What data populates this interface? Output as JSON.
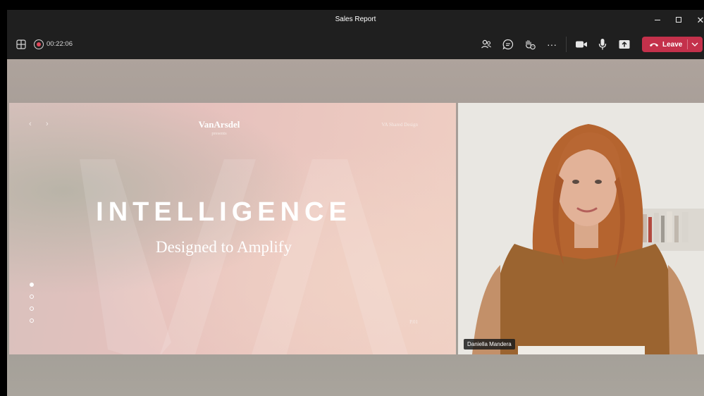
{
  "window": {
    "title": "Sales Report",
    "controls": {
      "minimize": "minimize",
      "maximize": "maximize",
      "close": "✕"
    }
  },
  "toolbar": {
    "layout_icon": "grid-layout-icon",
    "recording_icon": "recording-icon",
    "timer": "00:22:06",
    "more": "···",
    "leave_label": "Leave"
  },
  "slide": {
    "brand": "VanArsdel",
    "brand_sub": "presents",
    "shared_design": "VA Shared Design",
    "heading": "INTELLIGENCE",
    "subheading": "Designed to Amplify",
    "page_number": "P.01",
    "nav_prev": "‹",
    "nav_next": "›",
    "dots_total": 4,
    "dots_active_index": 0
  },
  "participant": {
    "name": "Daniella Mandera"
  },
  "colors": {
    "leave": "#c4314b",
    "toolbar_bg": "#1f1f1f",
    "recording": "#e0485a"
  }
}
